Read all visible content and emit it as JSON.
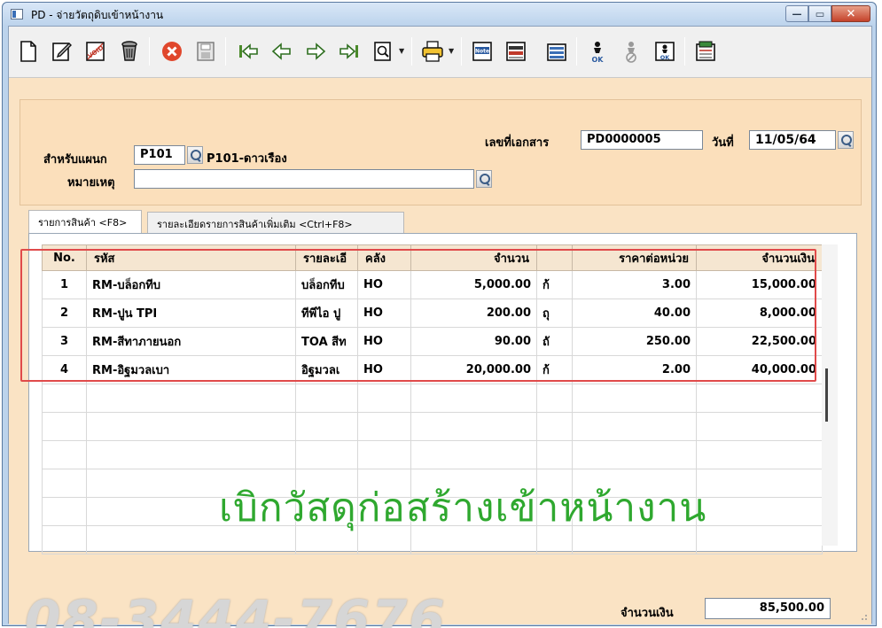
{
  "window": {
    "title": "PD - จ่ายวัตถุดิบเข้าหน้างาน"
  },
  "toolbar": {
    "buttons": [
      "new-icon",
      "edit-icon",
      "void-icon",
      "delete-icon",
      "cancel-icon",
      "save-icon",
      "first-icon",
      "prev-icon",
      "next-icon",
      "last-icon",
      "preview-icon",
      "print-icon",
      "note-icon",
      "attach-icon",
      "report-icon",
      "approve-icon",
      "unapprove-icon",
      "approve-doc-icon",
      "export-icon"
    ],
    "labels": {
      "void": "VOID",
      "note": "Note",
      "ok": "OK"
    }
  },
  "header": {
    "doc_no_label": "เลขที่เอกสาร",
    "doc_no": "PD0000005",
    "date_label": "วันที่",
    "date": "11/05/64",
    "dept_label": "สำหรับแผนก",
    "dept_code": "P101",
    "dept_name": "P101-ดาวเรือง",
    "remark_label": "หมายเหตุ",
    "remark": ""
  },
  "tabs": [
    {
      "label": "รายการสินค้า <F8>"
    },
    {
      "label": "รายละเอียดรายการสินค้าเพิ่มเติม <Ctrl+F8>"
    }
  ],
  "grid": {
    "columns": [
      "No.",
      "รหัส",
      "รายละเอี",
      "คลัง",
      "จำนวน",
      "",
      "ราคาต่อหน่วย",
      "จำนวนเงิน"
    ],
    "rows": [
      {
        "no": "1",
        "code": "RM-บล็อกทีบ",
        "desc": "บล็อกทีบ",
        "wh": "HO",
        "qty": "5,000.00",
        "unit": "ก้",
        "price": "3.00",
        "amount": "15,000.00"
      },
      {
        "no": "2",
        "code": "RM-ปูน TPI",
        "desc": "ทีพีไอ ปู",
        "wh": "HO",
        "qty": "200.00",
        "unit": "ถุ",
        "price": "40.00",
        "amount": "8,000.00"
      },
      {
        "no": "3",
        "code": "RM-สีทาภายนอก",
        "desc": "TOA สีท",
        "wh": "HO",
        "qty": "90.00",
        "unit": "ถั",
        "price": "250.00",
        "amount": "22,500.00"
      },
      {
        "no": "4",
        "code": "RM-อิฐมวลเบา",
        "desc": "อิฐมวลเ",
        "wh": "HO",
        "qty": "20,000.00",
        "unit": "ก้",
        "price": "2.00",
        "amount": "40,000.00"
      }
    ]
  },
  "overlay": {
    "caption": "เบิกวัสดุก่อสร้างเข้าหน้างาน",
    "phone": "08-3444-7676"
  },
  "footer": {
    "total_label": "จำนวนเงิน",
    "total": "85,500.00"
  }
}
